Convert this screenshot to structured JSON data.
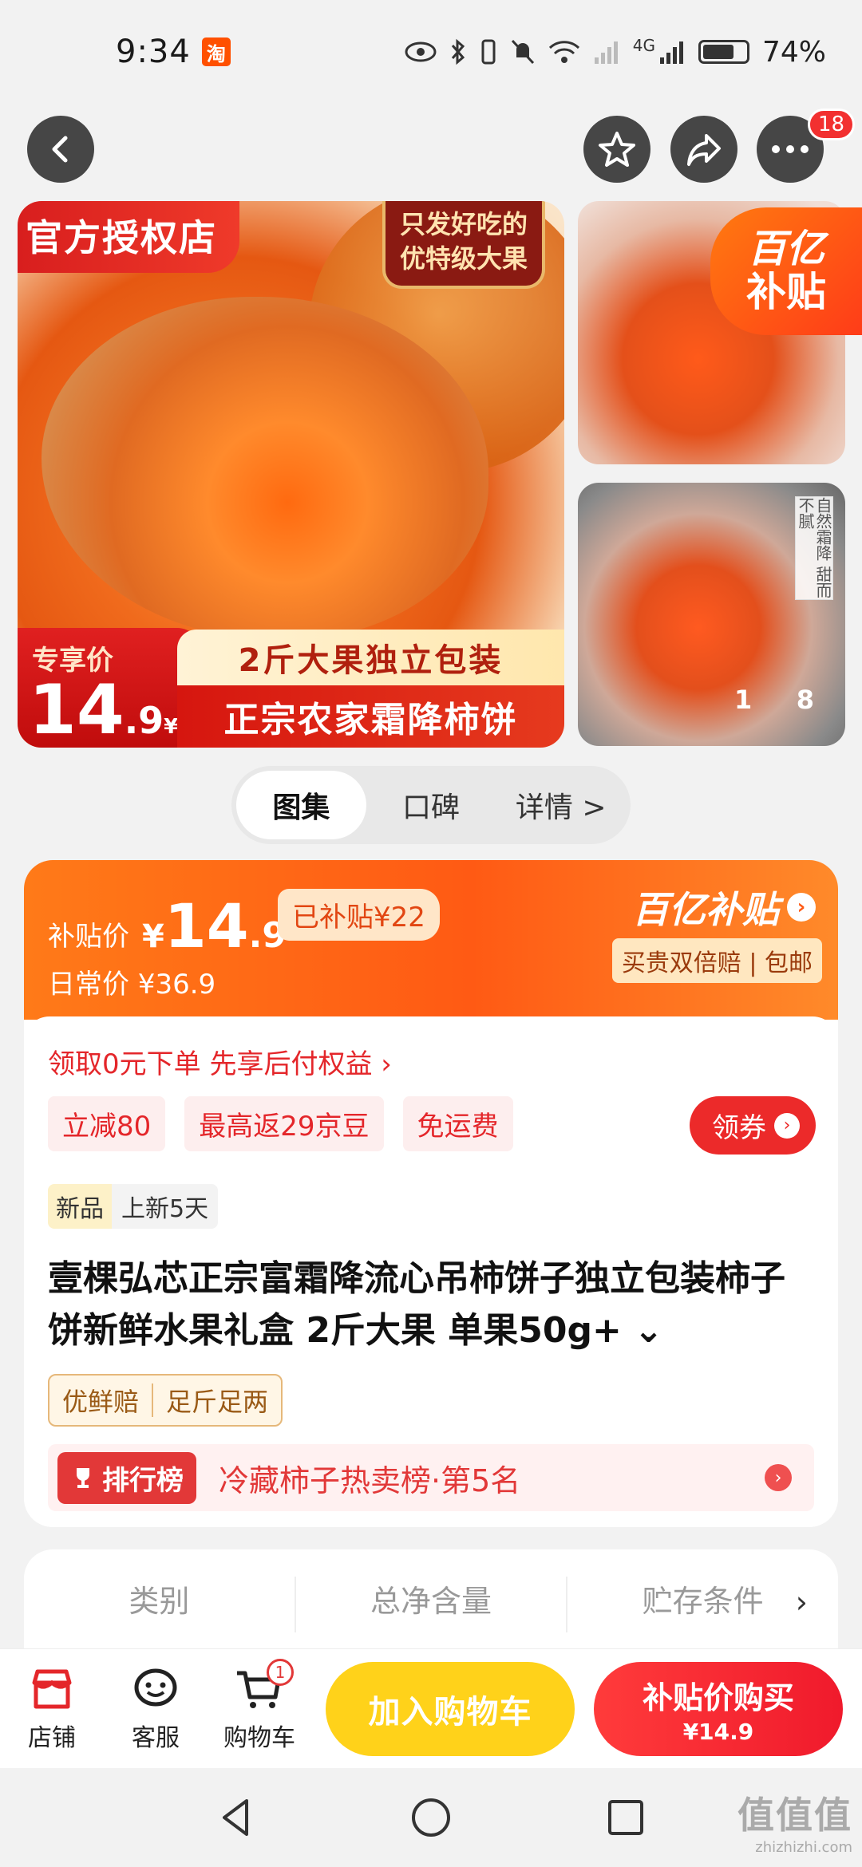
{
  "status_bar": {
    "time": "9:34",
    "app_icon": "淘",
    "signal_label": "4G",
    "battery": "74%"
  },
  "nav": {
    "back_icon": "chevron-left-icon",
    "fav_icon": "star-icon",
    "share_icon": "share-icon",
    "more_icon": "more-icon",
    "more_badge": "18"
  },
  "gallery": {
    "official_tag": "官方授权店",
    "grade_tag_line1": "只发好吃的",
    "grade_tag_line2": "优特级大果",
    "exclusive_label": "专享价",
    "price_int": "14",
    "price_dec": ".9",
    "price_yen": "¥",
    "band_top": "2斤大果独立包装",
    "band_bottom": "正宗农家霜降柿饼",
    "subsidy_badge_1": "百亿",
    "subsidy_badge_2": "补贴",
    "vertical_note": "自然霜降 甜而不腻",
    "counter_current": "1",
    "counter_total": "8"
  },
  "segmented": {
    "tabs": [
      "图集",
      "口碑",
      "详情 >"
    ],
    "active": 0
  },
  "subsidy": {
    "price_label": "补贴价",
    "yen": "¥",
    "price_int": "14",
    "price_dec": ".9",
    "saved": "已补贴¥22",
    "daily_label": "日常价 ¥36.9",
    "brand": "百亿补贴",
    "perk": "买贵双倍赔 | 包邮"
  },
  "offers": {
    "zero_order": "领取0元下单 先享后付权益 ›",
    "chips": [
      "立减80",
      "最高返29京豆",
      "免运费"
    ],
    "coupon_button": "领券"
  },
  "product": {
    "new_tag": "新品",
    "new_days": "上新5天",
    "title": "壹棵弘芯正宗富霜降流心吊柿饼子独立包装柿子饼新鲜水果礼盒 2斤大果 单果50g+ ⌄",
    "assure_1": "优鲜赔",
    "assure_2": "足斤足两",
    "rank_pill": "排行榜",
    "rank_text": "冷藏柿子热卖榜·第5名"
  },
  "specs": {
    "cols": [
      "类别",
      "总净含量",
      "贮存条件"
    ],
    "more": "›"
  },
  "actionbar": {
    "store": "店铺",
    "service": "客服",
    "cart": "购物车",
    "cart_badge": "1",
    "add_to_cart": "加入购物车",
    "buy_title": "补贴价购买",
    "buy_price": "¥14.9"
  },
  "watermark": {
    "logo": "值值值",
    "site": "zhizhizhi.com"
  },
  "colors": {
    "accent": "#ff5a14",
    "red": "#e4262a",
    "yellow": "#ffd21a"
  }
}
